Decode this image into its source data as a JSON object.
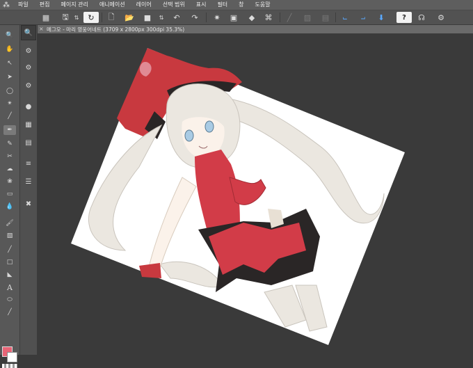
{
  "menubar": {
    "items": [
      "파일",
      "편집",
      "페이지 관리",
      "애니메이션",
      "레이어",
      "선택 범위",
      "표시",
      "필터",
      "창",
      "도움말"
    ]
  },
  "toolbar": {
    "icons": [
      "grid-icon",
      "save-icon",
      "updown-icon",
      "clip-icon",
      "new-page-icon",
      "open-folder-icon",
      "square-icon",
      "updown-icon",
      "undo-icon",
      "redo-icon",
      "transform-icon",
      "fit-icon",
      "erase-icon",
      "crop-icon",
      "dim-icon",
      "dim-icon",
      "dim-icon",
      "ruler-icon",
      "blue-ruler-icon",
      "blue-arrow-icon",
      "help-icon",
      "headset-icon",
      "gear-icon"
    ]
  },
  "document": {
    "tab_title": "메그오 - 마리 영웅어네트 (3709 x 2800px 300dpi 35.3%)"
  },
  "colors": {
    "main_color": "#e86476",
    "sub_color": "#ffffff",
    "background": "#3a3a3a",
    "dress_red": "#d23c48"
  }
}
